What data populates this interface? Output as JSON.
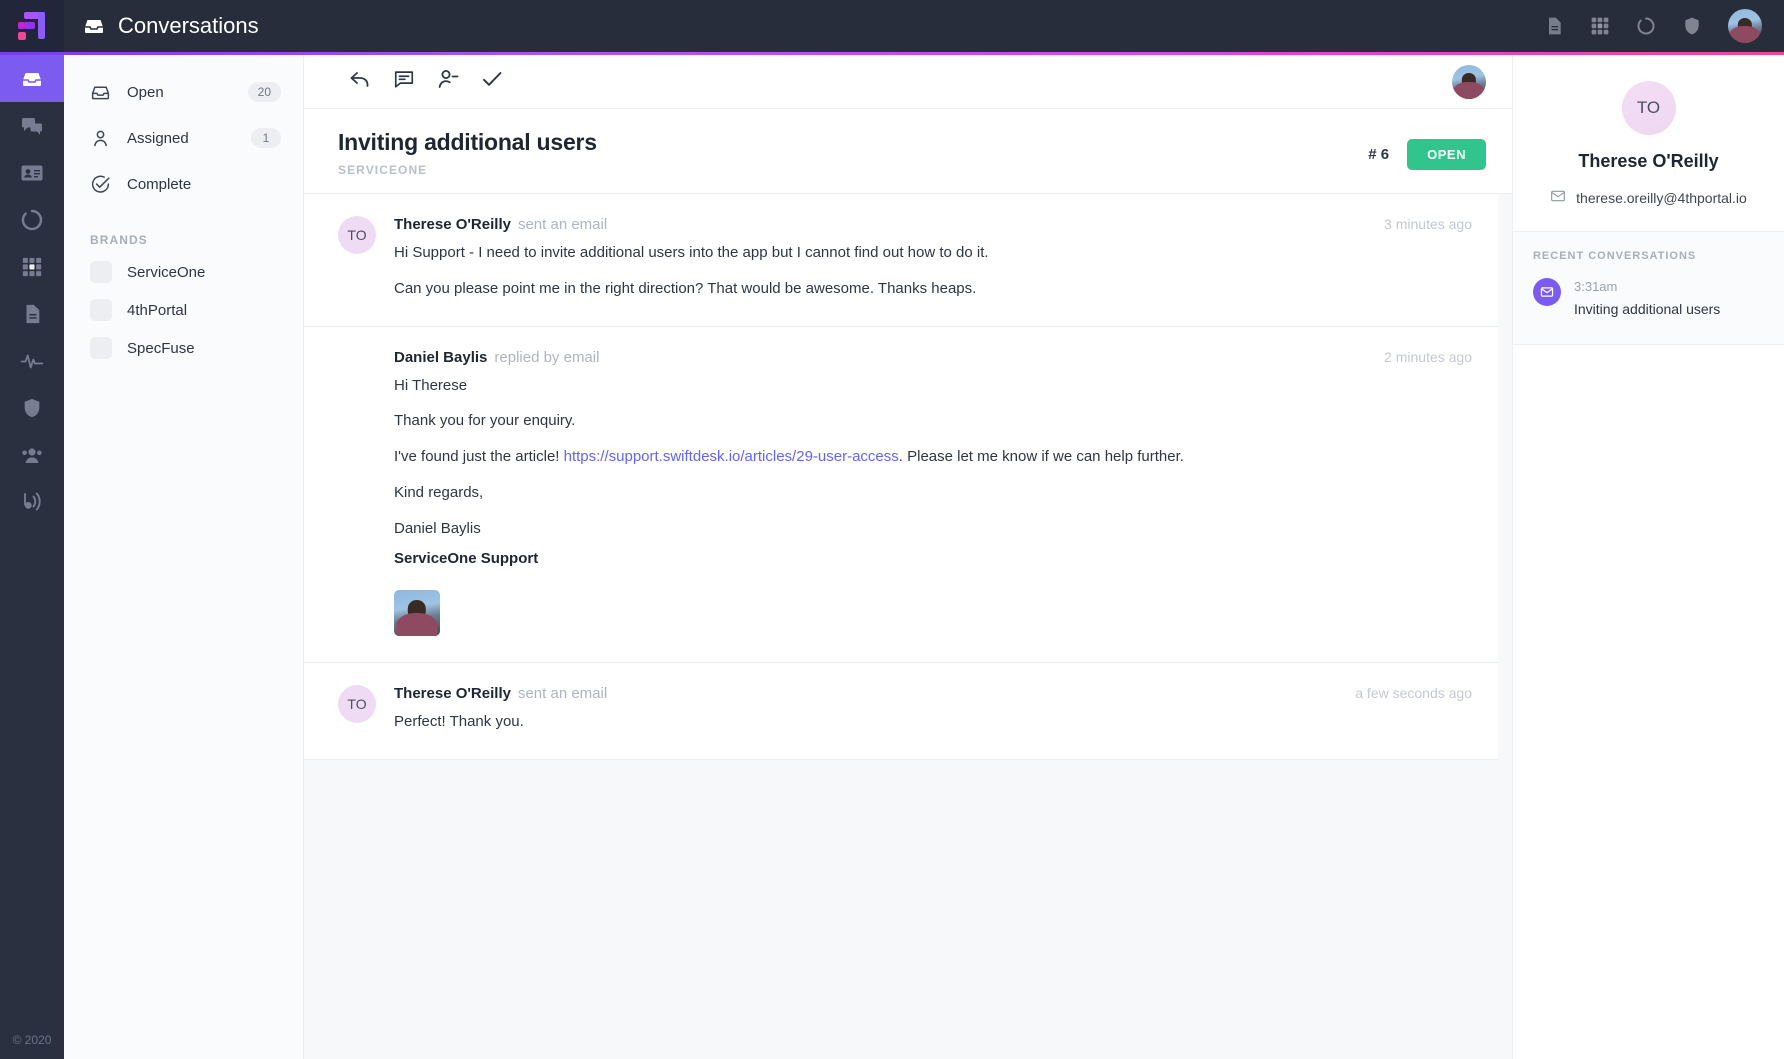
{
  "app": {
    "title": "Conversations",
    "title_icon": "inbox-icon",
    "logo": "swiftdesk-logo",
    "copyright": "© 2020"
  },
  "topbar": {
    "icons": [
      {
        "name": "document-icon"
      },
      {
        "name": "grid-apps-icon"
      },
      {
        "name": "circle-progress-icon"
      },
      {
        "name": "shield-icon"
      }
    ],
    "account_avatar": "user-avatar"
  },
  "rail": {
    "items": [
      {
        "name": "rail-item-inbox",
        "icon": "inbox-icon",
        "active": true
      },
      {
        "name": "rail-item-chat",
        "icon": "chat-bubbles-icon",
        "active": false
      },
      {
        "name": "rail-item-contacts",
        "icon": "contact-card-icon",
        "active": false
      },
      {
        "name": "rail-item-progress",
        "icon": "circle-progress-icon",
        "active": false
      },
      {
        "name": "rail-item-apps",
        "icon": "grid-apps-icon",
        "active": false
      },
      {
        "name": "rail-item-documents",
        "icon": "document-icon",
        "active": false
      },
      {
        "name": "rail-item-reports",
        "icon": "activity-pulse-icon",
        "active": false
      },
      {
        "name": "rail-item-security",
        "icon": "shield-icon",
        "active": false
      },
      {
        "name": "rail-item-teams",
        "icon": "people-icon",
        "active": false
      },
      {
        "name": "rail-item-broadcast",
        "icon": "broadcast-icon",
        "active": false
      }
    ]
  },
  "listnav": {
    "folders": [
      {
        "label": "Open",
        "count": "20",
        "icon": "inbox-icon"
      },
      {
        "label": "Assigned",
        "count": "1",
        "icon": "person-icon"
      },
      {
        "label": "Complete",
        "count": "",
        "icon": "check-circle-icon"
      }
    ],
    "brands_heading": "BRANDS",
    "brands": [
      {
        "label": "ServiceOne"
      },
      {
        "label": "4thPortal"
      },
      {
        "label": "SpecFuse"
      }
    ]
  },
  "toolbar": {
    "reply_label": "reply-icon",
    "note_label": "note-icon",
    "assign_label": "unassign-icon",
    "resolve_label": "check-icon"
  },
  "conversation": {
    "title": "Inviting additional users",
    "brand": "SERVICEONE",
    "ticket_number": "# 6",
    "status": "OPEN",
    "status_color": "#31c48d",
    "messages": [
      {
        "author": "Therese O'Reilly",
        "action": "sent an email",
        "time": "3 minutes ago",
        "avatar_initials": "TO",
        "avatar_type": "initials",
        "paragraphs": [
          "Hi Support - I need to invite additional users into the app but I cannot find out how to do it.",
          "Can you please point me in the right direction? That would be awesome. Thanks heaps."
        ]
      },
      {
        "author": "Daniel Baylis",
        "action": "replied by email",
        "time": "2 minutes ago",
        "avatar_initials": "",
        "avatar_type": "photo",
        "greeting": "Hi Therese",
        "paragraphs": [
          "Thank you for your enquiry."
        ],
        "link_pre": "I've found just the article! ",
        "link_text": "https://support.swiftdesk.io/articles/29-user-access",
        "link_post": ". Please let me know if we can help further.",
        "signoff": "Kind regards,",
        "signer": "Daniel Baylis",
        "signer_org": "ServiceOne Support",
        "attachment": "signature-image"
      },
      {
        "author": "Therese O'Reilly",
        "action": "sent an email",
        "time": "a few seconds ago",
        "avatar_initials": "TO",
        "avatar_type": "initials",
        "paragraphs": [
          "Perfect! Thank you."
        ]
      }
    ]
  },
  "contact": {
    "avatar_initials": "TO",
    "name": "Therese O'Reilly",
    "email": "therese.oreilly@4thportal.io",
    "recent_heading": "RECENT CONVERSATIONS",
    "recent": [
      {
        "time": "3:31am",
        "title": "Inviting additional users",
        "icon": "envelope-icon"
      }
    ]
  }
}
